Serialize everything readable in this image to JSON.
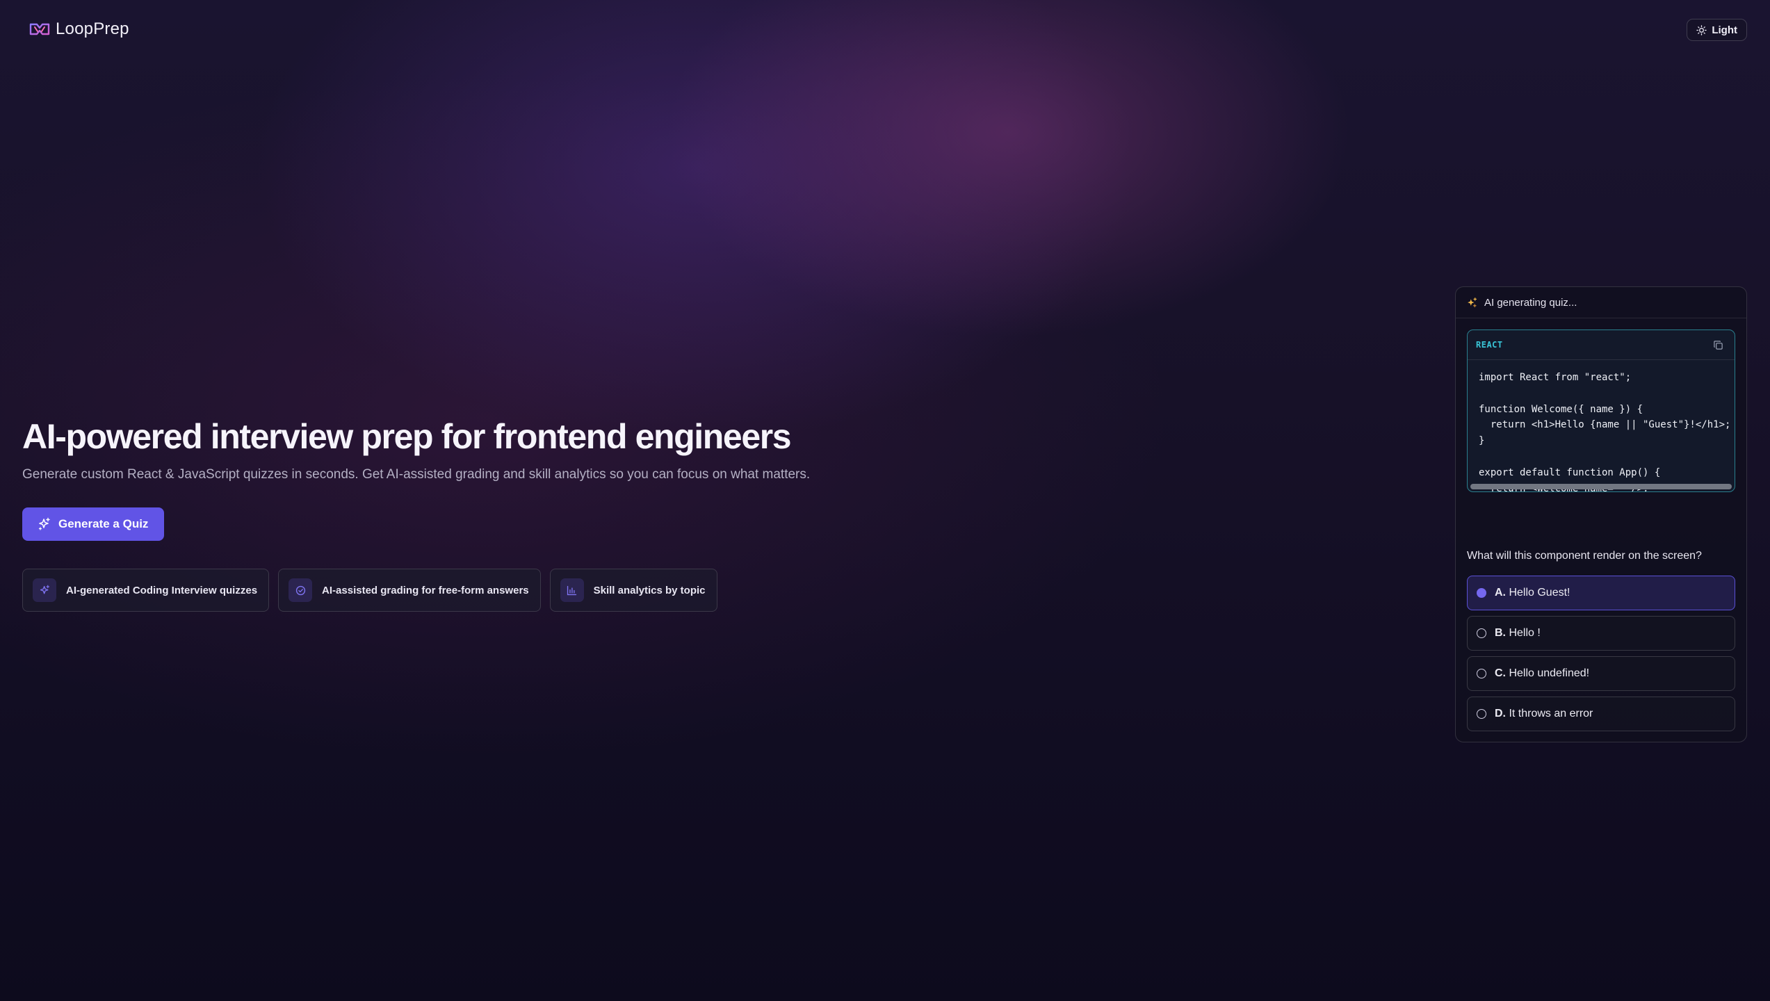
{
  "header": {
    "logo_text": "LoopPrep",
    "theme_toggle_label": "Light"
  },
  "hero": {
    "title": "AI-powered interview prep for frontend engineers",
    "subtitle": "Generate custom React & JavaScript quizzes in seconds. Get AI-assisted grading and skill analytics so you can focus on what matters.",
    "cta_label": "Generate a Quiz",
    "features": [
      {
        "label": "AI-generated Coding Interview quizzes",
        "icon": "sparkles-icon"
      },
      {
        "label": "AI-assisted grading for free-form answers",
        "icon": "check-circle-icon"
      },
      {
        "label": "Skill analytics by topic",
        "icon": "bar-chart-icon"
      }
    ]
  },
  "quiz": {
    "status": "AI generating quiz...",
    "code_language": "REACT",
    "code": "import React from \"react\";\n\nfunction Welcome({ name }) {\n  return <h1>Hello {name || \"Guest\"}!</h1>;\n}\n\nexport default function App() {\n  return <Welcome name=\"\" />;\n}",
    "question": "What will this component render on the screen?",
    "options": [
      {
        "letter": "A.",
        "text": "Hello Guest!",
        "selected": true
      },
      {
        "letter": "B.",
        "text": "Hello !",
        "selected": false
      },
      {
        "letter": "C.",
        "text": "Hello undefined!",
        "selected": false
      },
      {
        "letter": "D.",
        "text": "It throws an error",
        "selected": false
      }
    ]
  },
  "colors": {
    "accent": "#6154e6",
    "code_accent": "#39c6d8",
    "sparkle": "#f0b84a"
  }
}
